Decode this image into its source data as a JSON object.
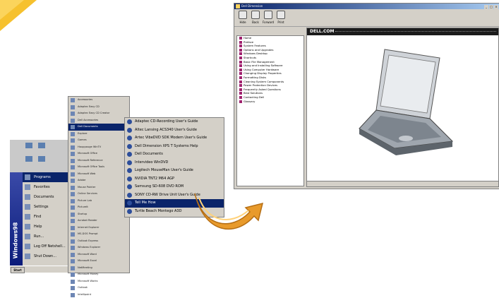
{
  "start_menu": {
    "side_label": "Windows98",
    "items": [
      {
        "label": "Programs",
        "selected": true
      },
      {
        "label": "Favorites",
        "selected": false
      },
      {
        "label": "Documents",
        "selected": false
      },
      {
        "label": "Settings",
        "selected": false
      },
      {
        "label": "Find",
        "selected": false
      },
      {
        "label": "Help",
        "selected": false
      },
      {
        "label": "Run...",
        "selected": false
      },
      {
        "label": "Log Off Netshell...",
        "selected": false
      },
      {
        "label": "Shut Down...",
        "selected": false
      }
    ],
    "start_label": "Start"
  },
  "programs_menu": {
    "items": [
      "Accessories",
      "Adaptec Easy CD",
      "Adaptec Easy CD Creator",
      "Dell Accessories",
      "Dell Documents",
      "Explore",
      "Games",
      "Hauppauge WinTV",
      "Microsoft Office",
      "Microsoft Reference",
      "Microsoft Office Tools",
      "Microsoft Web",
      "Adobe",
      "Mouse Pointer",
      "Online Services",
      "Picture Lab",
      "PictureIt",
      "Startup",
      "Acrobat Reader",
      "Internet Explorer",
      "MS-DOS Prompt",
      "Outlook Express",
      "Windows Explorer",
      "Microsoft Word",
      "Microsoft Excel",
      "NetMeeting",
      "Microsoft Money",
      "Microsoft Works",
      "Outlook",
      "Intellipoint"
    ],
    "selected_index": 4
  },
  "dell_documents_menu": {
    "items": [
      "Adaptec CD-Recording User's Guide",
      "Altec Lansing ACS340 User's Guide",
      "Artec VibeDVD SDK Modem User's Guide",
      "Dell Dimension XPS T Systems Help",
      "Dell Documents",
      "Intervideo WinDVD",
      "Logitech MouseMan User's Guide",
      "NVIDIA TNT2 M64 AGP",
      "Samsung SD-608 DVD ROM",
      "SONY CD-RW Drive Unit User's Guide",
      "Tell Me How",
      "Turtle Beach Montego A3D"
    ],
    "selected_index": 10
  },
  "help_window": {
    "title": "Dell Dimension",
    "toolbar": [
      {
        "label": "Hide",
        "icon": "hide-icon"
      },
      {
        "label": "Back",
        "icon": "back-icon"
      },
      {
        "label": "Forward",
        "icon": "forward-icon"
      },
      {
        "label": "Print",
        "icon": "print-icon"
      }
    ],
    "tabs": [
      {
        "label": "Contents",
        "active": true
      },
      {
        "label": "Index",
        "active": false
      },
      {
        "label": "Search",
        "active": false
      },
      {
        "label": "Glossary",
        "active": false
      }
    ],
    "toc": [
      "Home",
      "Preface",
      "System Features",
      "Options and Upgrades",
      "Windows Desktop",
      "Shortcuts",
      "Basic File Management",
      "Using and Installing Software",
      "Using Computer Hardware",
      "Changing Display Properties",
      "Formatting Disks",
      "Cleaning System Components",
      "Power Protection Devices",
      "Frequently Asked Questions",
      "Best Solutions",
      "Contacting Dell",
      "Glossary"
    ],
    "logo": "DELL.COM"
  },
  "colors": {
    "accent_yellow": "#f6c12e",
    "selection_blue": "#0a246a",
    "arrow_orange": "#e89a2b"
  }
}
